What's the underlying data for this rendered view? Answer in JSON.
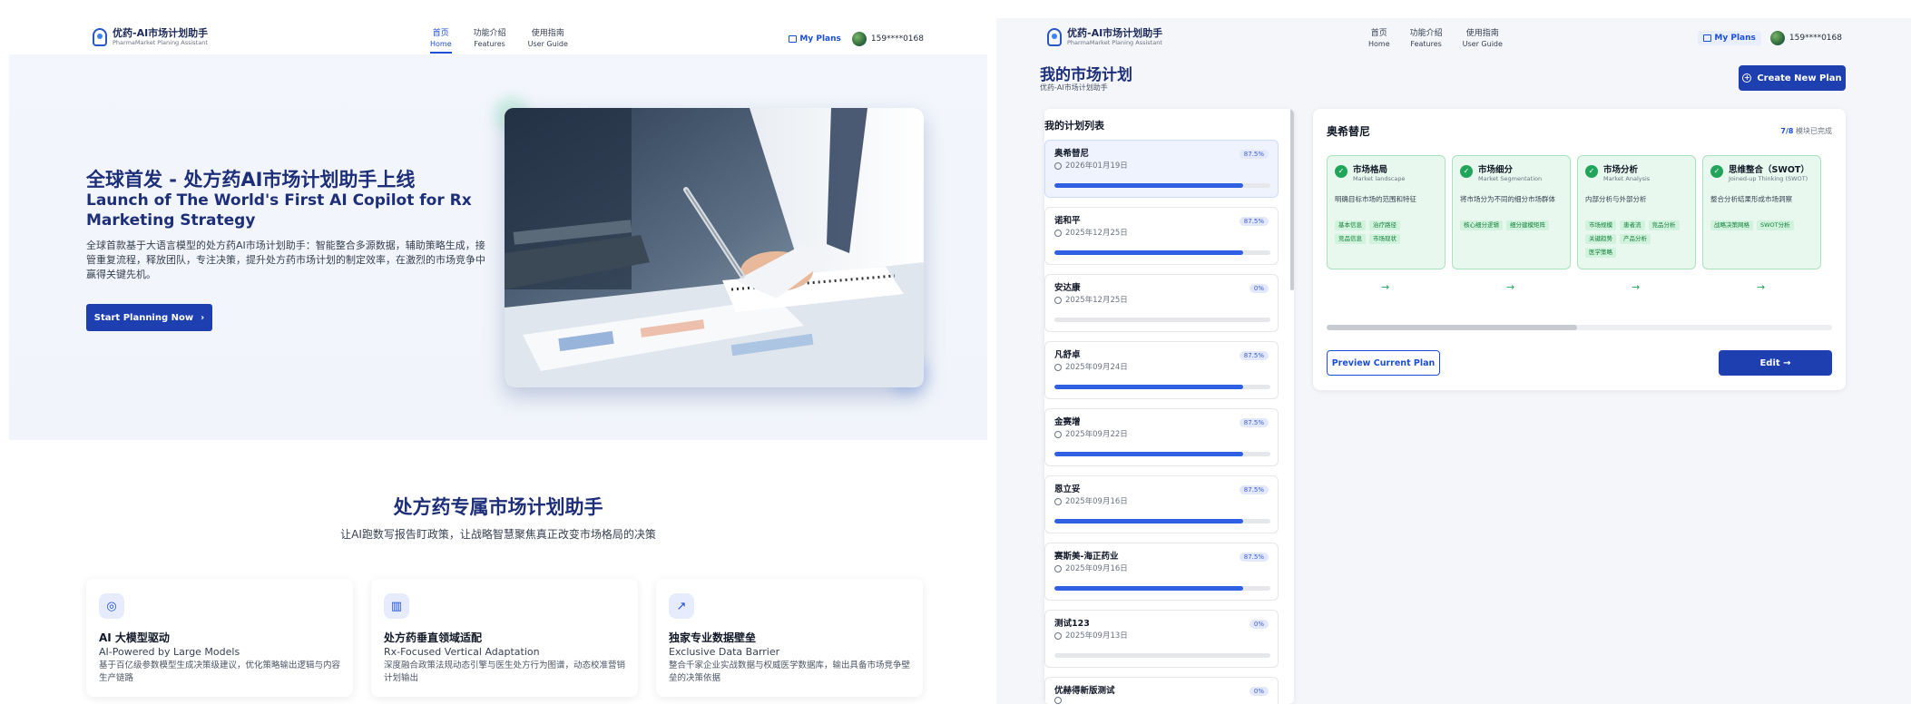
{
  "left": {
    "brand": {
      "title": "优药-AI市场计划助手",
      "subtitle": "PharmaMarket Planing Assistant"
    },
    "nav": [
      {
        "cn": "首页",
        "en": "Home"
      },
      {
        "cn": "功能介绍",
        "en": "Features"
      },
      {
        "cn": "使用指南",
        "en": "User Guide"
      }
    ],
    "my_plans": "My Plans",
    "phone": "159****0168",
    "hero": {
      "title_cn": "全球首发 - 处方药AI市场计划助手上线",
      "title_en": "Launch of The World's First AI Copilot for Rx Marketing Strategy",
      "desc": "全球首款基于大语言模型的处方药AI市场计划助手：智能整合多源数据，辅助策略生成，接管重复流程，释放团队，专注决策，提升处方药市场计划的制定效率，在激烈的市场竞争中赢得关键先机。",
      "cta": "Start Planning Now"
    },
    "section": {
      "title": "处方药专属市场计划助手",
      "subtitle": "让AI跑数写报告盯政策，让战略智慧聚焦真正改变市场格局的决策"
    },
    "features": [
      {
        "icon": "brain-icon",
        "glyph": "◎",
        "cn": "AI 大模型驱动",
        "en": "AI-Powered by Large Models",
        "desc": "基于百亿级参数模型生成决策级建议，优化策略输出逻辑与内容生产链路"
      },
      {
        "icon": "bar-chart-icon",
        "glyph": "▥",
        "cn": "处方药垂直领域适配",
        "en": "Rx-Focused Vertical Adaptation",
        "desc": "深度融合政策法规动态引擎与医生处方行为图谱，动态校准营销计划输出"
      },
      {
        "icon": "trend-icon",
        "glyph": "↗",
        "cn": "独家专业数据壁垒",
        "en": "Exclusive Data Barrier",
        "desc": "整合千家企业实战数据与权威医学数据库，输出具备市场竞争壁垒的决策依据"
      }
    ]
  },
  "right": {
    "brand": {
      "title": "优药-AI市场计划助手",
      "subtitle": "PharmaMarket Planing Assistant"
    },
    "nav": [
      {
        "cn": "首页",
        "en": "Home"
      },
      {
        "cn": "功能介绍",
        "en": "Features"
      },
      {
        "cn": "使用指南",
        "en": "User Guide"
      }
    ],
    "my_plans": "My Plans",
    "phone": "159****0168",
    "title": "我的市场计划",
    "subtitle": "优药-AI市场计划助手",
    "create_button": "Create New Plan",
    "list_title": "我的计划列表",
    "plans": [
      {
        "name": "奥希替尼",
        "date": "2026年01月19日",
        "badge": "87.5%",
        "progress": 0.875
      },
      {
        "name": "诺和平",
        "date": "2025年12月25日",
        "badge": "87.5%",
        "progress": 0.875
      },
      {
        "name": "安达康",
        "date": "2025年12月25日",
        "badge": "0%",
        "progress": 0
      },
      {
        "name": "凡舒卓",
        "date": "2025年09月24日",
        "badge": "87.5%",
        "progress": 0.875
      },
      {
        "name": "金赛增",
        "date": "2025年09月22日",
        "badge": "87.5%",
        "progress": 0.875
      },
      {
        "name": "恩立妥",
        "date": "2025年09月16日",
        "badge": "87.5%",
        "progress": 0.875
      },
      {
        "name": "赛斯美-海正药业",
        "date": "2025年09月16日",
        "badge": "87.5%",
        "progress": 0.875
      },
      {
        "name": "测试123",
        "date": "2025年09月13日",
        "badge": "0%",
        "progress": 0
      },
      {
        "name": "优赫得新版测试",
        "date": "",
        "badge": "0%",
        "progress": 0
      }
    ],
    "detail": {
      "title": "奥希替尼",
      "progress_num": "7/8",
      "progress_label": "模块已完成",
      "modules": [
        {
          "cn": "市场格局",
          "en": "Market landscape",
          "desc": "明确目标市场的范围和特征",
          "tags": [
            "基本信息",
            "治疗路径",
            "竞品信息",
            "市场现状"
          ]
        },
        {
          "cn": "市场细分",
          "en": "Market Segmentation",
          "desc": "将市场分为不同的细分市场群体",
          "tags": [
            "核心细分逻辑",
            "细分建模矩阵"
          ]
        },
        {
          "cn": "市场分析",
          "en": "Market Analysis",
          "desc": "内部分析与外部分析",
          "tags": [
            "市场规模",
            "患者流",
            "竞品分析",
            "关键趋势",
            "产品分析",
            "医学策略"
          ]
        },
        {
          "cn": "思维整合（SWOT）",
          "en": "Joined-up Thinking (SWOT)",
          "desc": "整合分析结果形成市场洞察",
          "tags": [
            "战略决策网格",
            "SWOT分析"
          ]
        }
      ],
      "preview_button": "Preview Current Plan",
      "edit_button": "Edit →"
    }
  }
}
